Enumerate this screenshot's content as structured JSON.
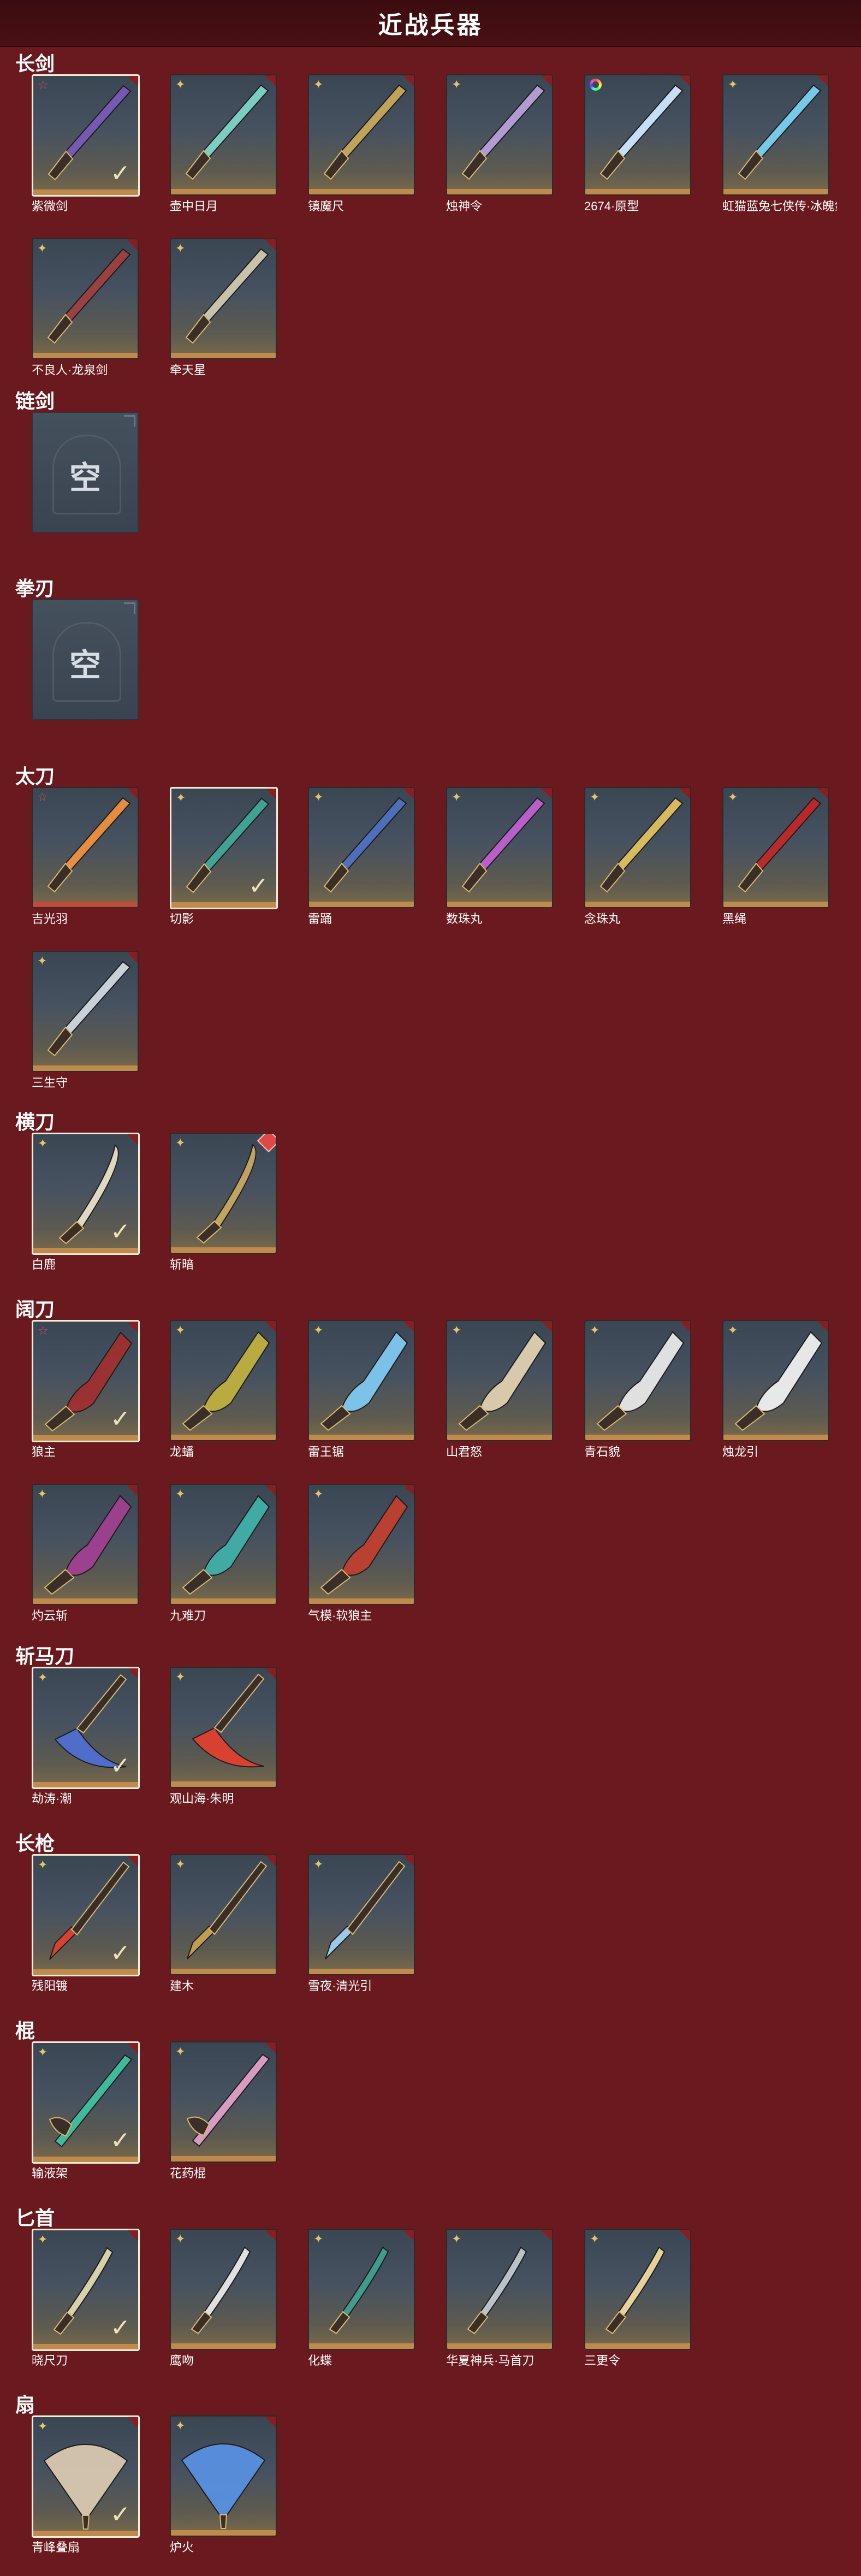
{
  "header": {
    "title": "近战兵器"
  },
  "colors": {
    "background": "#6a1a1f",
    "header_bg": "#3a0c0f",
    "gold_bar": "#c08a4c",
    "red_bar": "#c14a3a"
  },
  "sections": [
    {
      "title": "长剑",
      "items": [
        {
          "name": "紫微剑",
          "rarity": "red-star",
          "selected": true,
          "bar": "gold",
          "weapon": "sword",
          "tint": "#7a5ab8"
        },
        {
          "name": "壶中日月",
          "rarity": "gold",
          "selected": false,
          "bar": "gold",
          "weapon": "sword",
          "tint": "#7fd4c8"
        },
        {
          "name": "镇魔尺",
          "rarity": "gold",
          "selected": false,
          "bar": "gold",
          "weapon": "sword",
          "tint": "#c8a85a"
        },
        {
          "name": "烛神令",
          "rarity": "gold",
          "selected": false,
          "bar": "gold",
          "weapon": "sword",
          "tint": "#b8a0d8"
        },
        {
          "name": "2674·原型",
          "rarity": "rainbow",
          "selected": false,
          "bar": "gold",
          "weapon": "sword",
          "tint": "#cfe6ff"
        },
        {
          "name": "虹猫蓝兔七侠传·冰魄剑",
          "rarity": "gold",
          "selected": false,
          "bar": "gold",
          "weapon": "sword",
          "tint": "#7ad0f0"
        },
        {
          "name": "不良人·龙泉剑",
          "rarity": "gold",
          "selected": false,
          "bar": "gold",
          "weapon": "sword",
          "tint": "#a04040"
        },
        {
          "name": "牵天星",
          "rarity": "gold",
          "selected": false,
          "bar": "gold",
          "weapon": "sword",
          "tint": "#d0c8b0"
        }
      ]
    },
    {
      "title": "链剑",
      "items": [
        {
          "name": "",
          "empty": true,
          "empty_label": "空"
        }
      ]
    },
    {
      "title": "拳刃",
      "items": [
        {
          "name": "",
          "empty": true,
          "empty_label": "空"
        }
      ]
    },
    {
      "title": "太刀",
      "items": [
        {
          "name": "吉光羽",
          "rarity": "red-star",
          "selected": false,
          "bar": "red",
          "weapon": "katana",
          "tint": "#f09040"
        },
        {
          "name": "切影",
          "rarity": "gold",
          "selected": true,
          "bar": "gold",
          "weapon": "katana",
          "tint": "#40a898"
        },
        {
          "name": "雷踊",
          "rarity": "gold",
          "selected": false,
          "bar": "gold",
          "weapon": "katana",
          "tint": "#5070c0"
        },
        {
          "name": "数珠丸",
          "rarity": "gold",
          "selected": false,
          "bar": "gold",
          "weapon": "katana",
          "tint": "#c060d0"
        },
        {
          "name": "念珠丸",
          "rarity": "gold",
          "selected": false,
          "bar": "gold",
          "weapon": "katana",
          "tint": "#e0c060"
        },
        {
          "name": "黑绳",
          "rarity": "gold",
          "selected": false,
          "bar": "gold",
          "weapon": "katana",
          "tint": "#c02828"
        },
        {
          "name": "三生守",
          "rarity": "gold",
          "selected": false,
          "bar": "gold",
          "weapon": "katana",
          "tint": "#d0d8e0"
        }
      ]
    },
    {
      "title": "横刀",
      "items": [
        {
          "name": "白鹿",
          "rarity": "gold",
          "selected": true,
          "bar": "gold",
          "weapon": "saber",
          "tint": "#e8e0c8"
        },
        {
          "name": "斩暗",
          "rarity": "gold",
          "selected": false,
          "bar": "gold",
          "weapon": "saber",
          "tint": "#c8a860",
          "badge": "diamond"
        }
      ]
    },
    {
      "title": "阔刀",
      "items": [
        {
          "name": "狼主",
          "rarity": "red-star",
          "selected": true,
          "bar": "gold",
          "weapon": "broad",
          "tint": "#a03030"
        },
        {
          "name": "龙蟠",
          "rarity": "gold",
          "selected": false,
          "bar": "gold",
          "weapon": "broad",
          "tint": "#c0b040"
        },
        {
          "name": "雷王锯",
          "rarity": "gold",
          "selected": false,
          "bar": "gold",
          "weapon": "broad",
          "tint": "#80c8f0"
        },
        {
          "name": "山君怒",
          "rarity": "gold",
          "selected": false,
          "bar": "gold",
          "weapon": "broad",
          "tint": "#e0d0b0"
        },
        {
          "name": "青石貌",
          "rarity": "gold",
          "selected": false,
          "bar": "gold",
          "weapon": "broad",
          "tint": "#e8e8e8"
        },
        {
          "name": "烛龙引",
          "rarity": "gold",
          "selected": false,
          "bar": "gold",
          "weapon": "broad",
          "tint": "#f0f0f0"
        },
        {
          "name": "灼云斩",
          "rarity": "gold",
          "selected": false,
          "bar": "gold",
          "weapon": "broad",
          "tint": "#a04090"
        },
        {
          "name": "九难刀",
          "rarity": "gold",
          "selected": false,
          "bar": "gold",
          "weapon": "broad",
          "tint": "#40b0a8"
        },
        {
          "name": "气模·软狼主",
          "rarity": "gold",
          "selected": false,
          "bar": "gold",
          "weapon": "broad",
          "tint": "#c04030"
        }
      ]
    },
    {
      "title": "斩马刀",
      "items": [
        {
          "name": "劫涛·潮",
          "rarity": "gold",
          "selected": true,
          "bar": "gold",
          "weapon": "glaive",
          "tint": "#5070d0"
        },
        {
          "name": "观山海·朱明",
          "rarity": "gold",
          "selected": false,
          "bar": "gold",
          "weapon": "glaive",
          "tint": "#e04030"
        }
      ]
    },
    {
      "title": "长枪",
      "items": [
        {
          "name": "残阳镀",
          "rarity": "gold",
          "selected": true,
          "bar": "gold",
          "weapon": "spear",
          "tint": "#e04030"
        },
        {
          "name": "建木",
          "rarity": "gold",
          "selected": false,
          "bar": "gold",
          "weapon": "spear",
          "tint": "#c8a050"
        },
        {
          "name": "雪夜·清光引",
          "rarity": "gold",
          "selected": false,
          "bar": "gold",
          "weapon": "spear",
          "tint": "#a0d0f0"
        }
      ]
    },
    {
      "title": "棍",
      "items": [
        {
          "name": "输液架",
          "rarity": "gold",
          "selected": true,
          "bar": "gold",
          "weapon": "staff",
          "tint": "#40c0a0"
        },
        {
          "name": "花药棍",
          "rarity": "gold",
          "selected": false,
          "bar": "gold",
          "weapon": "staff",
          "tint": "#e0a0c8"
        }
      ]
    },
    {
      "title": "匕首",
      "items": [
        {
          "name": "晓尺刀",
          "rarity": "gold",
          "selected": true,
          "bar": "gold",
          "weapon": "dagger",
          "tint": "#e0d8b0"
        },
        {
          "name": "鹰吻",
          "rarity": "gold",
          "selected": false,
          "bar": "gold",
          "weapon": "dagger",
          "tint": "#e8e8e8"
        },
        {
          "name": "化蝶",
          "rarity": "gold",
          "selected": false,
          "bar": "gold",
          "weapon": "dagger",
          "tint": "#40a090"
        },
        {
          "name": "华夏神兵·马首刀",
          "rarity": "gold",
          "selected": false,
          "bar": "gold",
          "weapon": "dagger",
          "tint": "#c0c8d0"
        },
        {
          "name": "三更令",
          "rarity": "gold",
          "selected": false,
          "bar": "gold",
          "weapon": "dagger",
          "tint": "#f0d8a0"
        }
      ]
    },
    {
      "title": "扇",
      "items": [
        {
          "name": "青峰叠扇",
          "rarity": "gold",
          "selected": true,
          "bar": "gold",
          "weapon": "fan",
          "tint": "#d8c8b0"
        },
        {
          "name": "炉火",
          "rarity": "gold",
          "selected": false,
          "bar": "gold",
          "weapon": "fan",
          "tint": "#5890e0"
        }
      ]
    }
  ],
  "icons": {
    "rarity_gold": "gold-four-point-star-icon",
    "rarity_red": "red-star-icon",
    "rarity_rainbow": "rainbow-ring-icon",
    "selected": "checkmark-icon",
    "badge": "red-diamond-badge-icon"
  }
}
